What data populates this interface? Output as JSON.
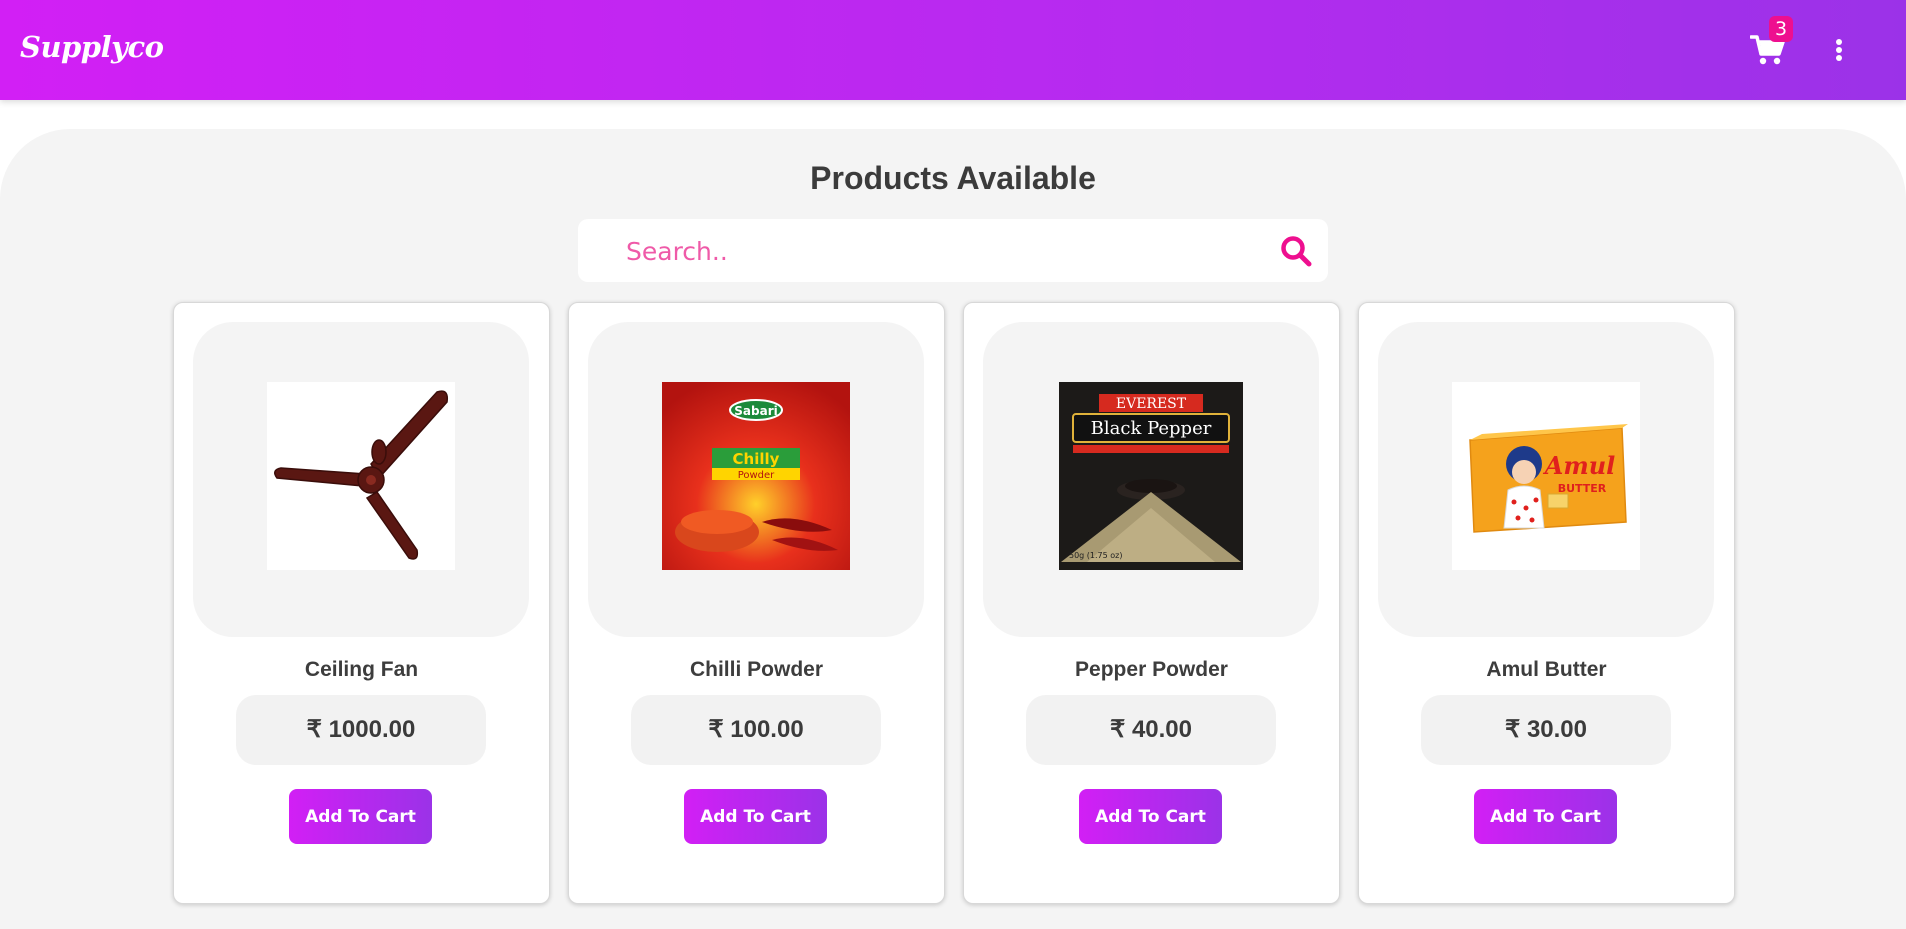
{
  "header": {
    "brand": "Supplyco",
    "cart_count": "3",
    "cart_icon": "shopping-cart-icon",
    "menu_icon": "kebab-menu-icon"
  },
  "main": {
    "title": "Products Available",
    "search": {
      "placeholder": "Search..",
      "value": "",
      "icon": "search-icon"
    }
  },
  "products": [
    {
      "name": "Ceiling Fan",
      "price": "₹ 1000.00",
      "button": "Add To Cart",
      "image": "ceiling-fan"
    },
    {
      "name": "Chilli Powder",
      "price": "₹ 100.00",
      "button": "Add To Cart",
      "image": "sabari-chilly-powder-pack"
    },
    {
      "name": "Pepper Powder",
      "price": "₹ 40.00",
      "button": "Add To Cart",
      "image": "everest-black-pepper-box"
    },
    {
      "name": "Amul Butter",
      "price": "₹ 30.00",
      "button": "Add To Cart",
      "image": "amul-butter-pack"
    }
  ],
  "images": {
    "chilli_brand": "Sabari",
    "chilli_label": "Chilly",
    "chilli_sub": "Powder",
    "pepper_brand": "EVEREST",
    "pepper_label": "Black Pepper",
    "pepper_weight": "50g (1.75 oz)",
    "butter_brand": "Amul",
    "butter_label": "BUTTER"
  },
  "colors": {
    "header_gradient_start": "#d21ff5",
    "header_gradient_end": "#9b32e8",
    "badge": "#ee0f8f",
    "accent_pink": "#ee0f8f"
  }
}
